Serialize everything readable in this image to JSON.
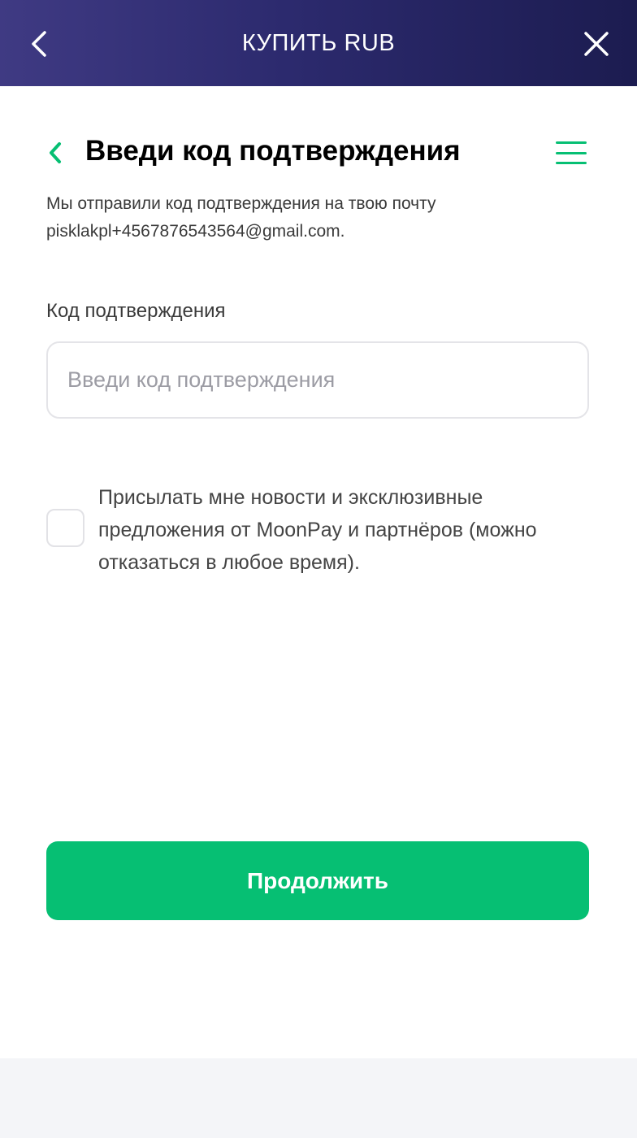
{
  "topbar": {
    "title": "КУПИТЬ RUB",
    "back_icon": "chevron-left-icon",
    "close_icon": "close-icon",
    "gradient": [
      "#3f3a83",
      "#1c1c50"
    ]
  },
  "header": {
    "back_icon": "chevron-left-icon",
    "title": "Введи код подтверждения",
    "menu_icon": "hamburger-menu-icon"
  },
  "description": {
    "line1": "Мы отправили код подтверждения на твою почту",
    "email": "pisklakpl+4567876543564@gmail.com."
  },
  "code_field": {
    "label": "Код подтверждения",
    "placeholder": "Введи код подтверждения",
    "value": ""
  },
  "newsletter": {
    "checked": false,
    "text": "Присылать мне новости и эксклюзивные предложения от MoonPay и партнёров (можно отказаться в любое время)."
  },
  "actions": {
    "continue_label": "Продолжить"
  },
  "colors": {
    "accent": "#06bf73",
    "topbar_start": "#3f3a83",
    "topbar_end": "#1c1c50",
    "text": "#3a3a3a"
  }
}
